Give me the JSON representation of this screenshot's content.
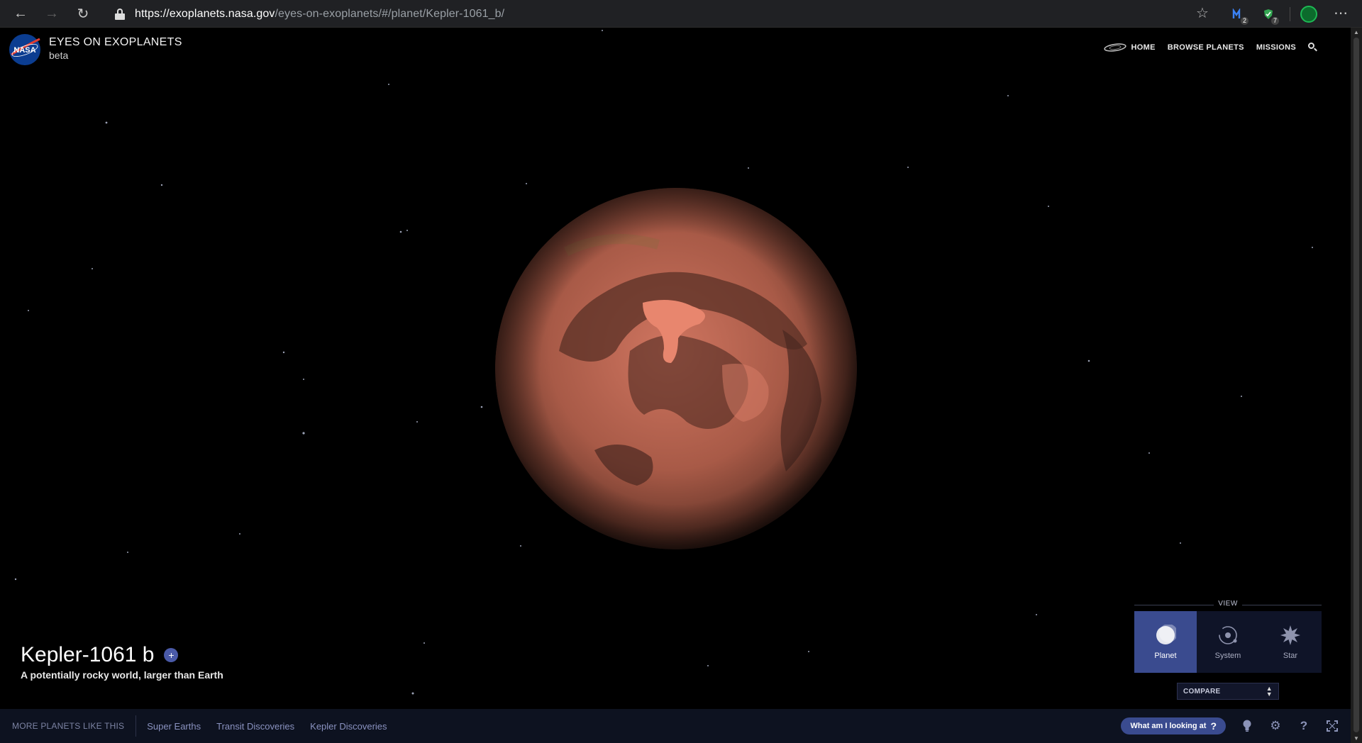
{
  "browser": {
    "url_host": "https://exoplanets.nasa.gov",
    "url_path": "/eyes-on-exoplanets/#/planet/Kepler-1061_b/",
    "ext_badge_1": "2",
    "ext_badge_2": "7"
  },
  "brand": {
    "logo_text": "NASA",
    "title": "EYES ON EXOPLANETS",
    "subtitle": "beta"
  },
  "topnav": {
    "home": "HOME",
    "browse": "BROWSE PLANETS",
    "missions": "MISSIONS"
  },
  "planet": {
    "name": "Kepler-1061 b",
    "description": "A potentially rocky world, larger than Earth",
    "plus": "+"
  },
  "view": {
    "label": "VIEW",
    "buttons": [
      {
        "label": "Planet",
        "icon": "planet-icon",
        "active": true
      },
      {
        "label": "System",
        "icon": "system-orbit-icon",
        "active": false
      },
      {
        "label": "Star",
        "icon": "star-burst-icon",
        "active": false
      }
    ],
    "compare": "COMPARE"
  },
  "bottom": {
    "label": "MORE PLANETS LIKE THIS",
    "links": [
      "Super Earths",
      "Transit Discoveries",
      "Kepler Discoveries"
    ],
    "help_button": "What am I looking at",
    "help_glyph": "?",
    "icons": [
      "lightbulb-icon",
      "settings-gear-icon",
      "help-question-icon",
      "fullscreen-icon"
    ]
  },
  "colors": {
    "accent": "#3a4b8f",
    "bottombar": "#0d1220",
    "planet_base": "#b7604a"
  }
}
